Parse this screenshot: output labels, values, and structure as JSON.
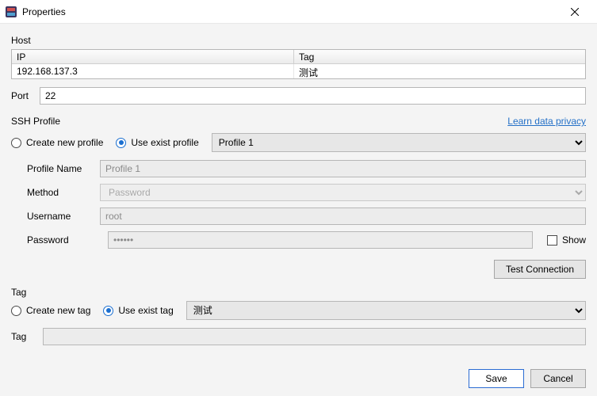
{
  "window": {
    "title": "Properties"
  },
  "host": {
    "section_label": "Host",
    "ip_header": "IP",
    "tag_header": "Tag",
    "ip_value": "192.168.137.3",
    "tag_value": "测试"
  },
  "port": {
    "label": "Port",
    "value": "22"
  },
  "ssh": {
    "section_label": "SSH Profile",
    "privacy_link": "Learn data privacy",
    "create_label": "Create new profile",
    "use_label": "Use exist profile",
    "selected_mode": "use",
    "profile_selected": "Profile 1",
    "fields": {
      "profile_name_label": "Profile Name",
      "profile_name_value": "Profile 1",
      "method_label": "Method",
      "method_value": "Password",
      "username_label": "Username",
      "username_value": "root",
      "password_label": "Password",
      "password_value": "••••••",
      "show_label": "Show"
    },
    "test_button": "Test Connection"
  },
  "tag": {
    "section_label": "Tag",
    "create_label": "Create new tag",
    "use_label": "Use exist tag",
    "selected_mode": "use",
    "tag_selected": "测试",
    "field_label": "Tag",
    "field_value": ""
  },
  "footer": {
    "save": "Save",
    "cancel": "Cancel"
  }
}
